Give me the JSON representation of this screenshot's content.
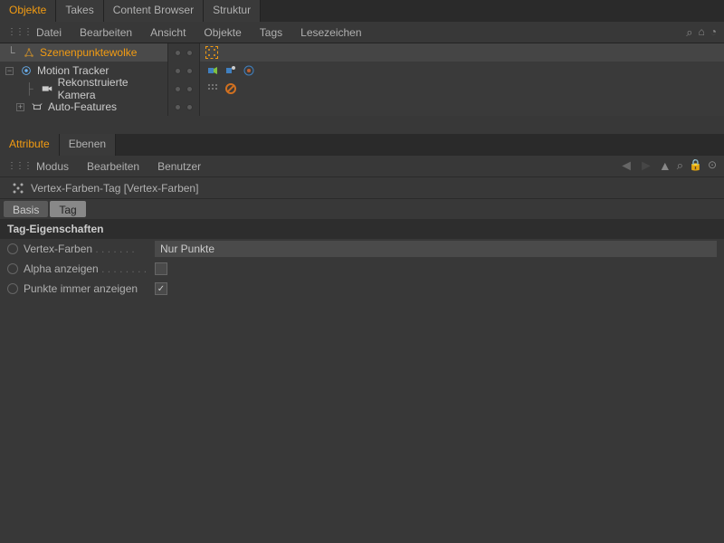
{
  "topTabs": {
    "objekte": "Objekte",
    "takes": "Takes",
    "contentBrowser": "Content Browser",
    "struktur": "Struktur"
  },
  "objectMenu": {
    "datei": "Datei",
    "bearbeiten": "Bearbeiten",
    "ansicht": "Ansicht",
    "objekte": "Objekte",
    "tags": "Tags",
    "lesezeichen": "Lesezeichen"
  },
  "tree": {
    "scene": "Szenenpunktewolke",
    "motionTracker": "Motion Tracker",
    "camera": "Rekonstruierte Kamera",
    "autoFeatures": "Auto-Features"
  },
  "attrTabs": {
    "attribute": "Attribute",
    "ebenen": "Ebenen"
  },
  "attrMenu": {
    "modus": "Modus",
    "bearbeiten": "Bearbeiten",
    "benutzer": "Benutzer"
  },
  "attrHeader": "Vertex-Farben-Tag [Vertex-Farben]",
  "subtabs": {
    "basis": "Basis",
    "tag": "Tag"
  },
  "section": "Tag-Eigenschaften",
  "props": {
    "vertexFarben": {
      "label": "Vertex-Farben",
      "value": "Nur Punkte"
    },
    "alphaAnzeigen": {
      "label": "Alpha anzeigen",
      "checked": false
    },
    "punkteAnzeigen": {
      "label": "Punkte immer anzeigen",
      "checked": true
    }
  }
}
